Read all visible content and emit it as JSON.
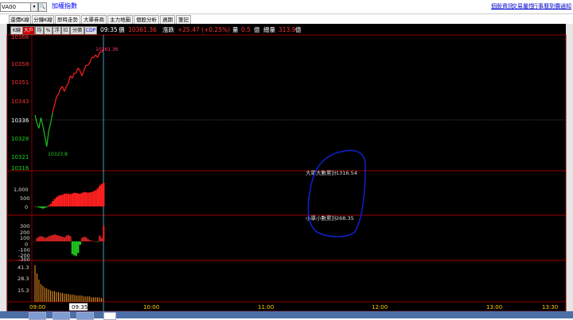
{
  "topbar": {
    "symbol_value": "VA00",
    "dropdown_icon": "▾",
    "search_icon": "🔍",
    "index_name": "加權指數",
    "links": [
      "個股資訊",
      "交易屬性",
      "行事曆",
      "到價通知"
    ]
  },
  "tabs": [
    {
      "label": "還價K線",
      "active": false
    },
    {
      "label": "分鐘K線",
      "active": false
    },
    {
      "label": "即時走勢",
      "active": true
    },
    {
      "label": "大單券商",
      "active": false
    },
    {
      "label": "主力地圖",
      "active": false
    },
    {
      "label": "個股分析",
      "active": false
    },
    {
      "label": "週期",
      "active": false
    },
    {
      "label": "筆記",
      "active": false
    }
  ],
  "toolbar": {
    "buttons": [
      "K線",
      "大戶",
      "均",
      "%",
      "浮",
      "拉",
      "分價",
      "CDP"
    ],
    "time": "09:35",
    "price_label": "價",
    "price_value": "10361.36",
    "change_label": "漲跌",
    "change_value": "+25.47 (+0.25%)",
    "volume_label": "量",
    "volume_value": "0.5",
    "volume_unit": "億",
    "total_label": "總量",
    "total_value": "313.9",
    "total_unit": "億"
  },
  "colors": {
    "up": "#ff2020",
    "down": "#20c020",
    "flat": "#ffffff",
    "grid_red": "#8b0000",
    "annotation": "#1020c0"
  },
  "chart_data": {
    "type": "line",
    "price_panel": {
      "yticks": [
        "10366",
        "10358",
        "10351",
        "10343",
        "10336",
        "10328",
        "10321",
        "10316"
      ],
      "reference": 10336,
      "high_label": "10361.36",
      "low_label": "10323.8",
      "x_time": [
        "09:00",
        "09:01",
        "09:02",
        "09:03",
        "09:04",
        "09:05",
        "09:06",
        "09:07",
        "09:08",
        "09:09",
        "09:10",
        "09:11",
        "09:12",
        "09:13",
        "09:14",
        "09:15",
        "09:16",
        "09:17",
        "09:18",
        "09:19",
        "09:20",
        "09:21",
        "09:22",
        "09:23",
        "09:24",
        "09:25",
        "09:26",
        "09:27",
        "09:28",
        "09:29",
        "09:30",
        "09:31",
        "09:32",
        "09:33",
        "09:34",
        "09:35"
      ],
      "values": [
        10336,
        10333,
        10331,
        10335,
        10332,
        10328,
        10324,
        10330,
        10333,
        10337,
        10340,
        10343,
        10344,
        10346,
        10347,
        10345,
        10347,
        10348,
        10351,
        10350,
        10352,
        10352,
        10354,
        10353,
        10351,
        10353,
        10355,
        10355,
        10356,
        10358,
        10358,
        10359,
        10358,
        10360,
        10360,
        10361.36
      ]
    },
    "big_order_panel": {
      "label": "大單大數累計",
      "value": "1316.54",
      "yticks": [
        "1,000",
        "500",
        "0"
      ],
      "values": [
        0,
        -30,
        -60,
        -90,
        -120,
        -80,
        -40,
        60,
        150,
        300,
        420,
        520,
        600,
        620,
        650,
        700,
        720,
        700,
        680,
        720,
        760,
        740,
        720,
        700,
        750,
        800,
        780,
        760,
        780,
        800,
        850,
        900,
        1000,
        1150,
        1250,
        1316
      ]
    },
    "small_order_panel": {
      "label": "小單小數累計",
      "value": "268.35",
      "yticks": [
        "300",
        "200",
        "100",
        "0",
        "-100",
        "-200",
        "-300"
      ],
      "values": [
        0,
        60,
        80,
        90,
        80,
        60,
        70,
        90,
        100,
        110,
        120,
        110,
        100,
        90,
        80,
        70,
        100,
        110,
        90,
        -220,
        -240,
        -250,
        -200,
        -60,
        60,
        80,
        70,
        40,
        20,
        10,
        5,
        0,
        -10,
        100,
        60,
        268
      ]
    },
    "volume_panel": {
      "yticks": [
        "41.3",
        "28.3",
        "15.3"
      ],
      "ymax": 41.3,
      "values": [
        41.3,
        32,
        25,
        20,
        18,
        16,
        15,
        14,
        13,
        12,
        12,
        11,
        11,
        10,
        10,
        9,
        9,
        9,
        8,
        8,
        8,
        7,
        7,
        7,
        7,
        6,
        6,
        6,
        6,
        5,
        5,
        5,
        5,
        5,
        4,
        4
      ]
    },
    "xticks": [
      "09:00",
      "09:35",
      "10:00",
      "11:00",
      "12:00",
      "13:00",
      "13:30"
    ]
  }
}
